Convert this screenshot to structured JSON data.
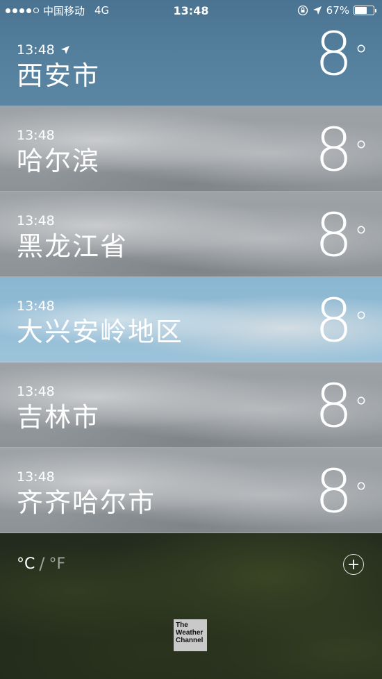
{
  "status_bar": {
    "carrier": "中国移动",
    "network": "4G",
    "time": "13:48",
    "battery_percent": "67%",
    "battery_level": 0.67,
    "signal_bars_filled": 4,
    "signal_bars_total": 5,
    "icons": [
      "rotation-lock-icon",
      "location-arrow-icon",
      "battery-icon"
    ]
  },
  "cities": [
    {
      "time": "13:48",
      "name": "西安市",
      "temp": "8",
      "degree": "°",
      "current_location": true,
      "bg": "rain"
    },
    {
      "time": "13:48",
      "name": "哈尔滨",
      "temp": "8",
      "degree": "°",
      "current_location": false,
      "bg": "cloudy"
    },
    {
      "time": "13:48",
      "name": "黑龙江省",
      "temp": "8",
      "degree": "°",
      "current_location": false,
      "bg": "cloudy"
    },
    {
      "time": "13:48",
      "name": "大兴安岭地区",
      "temp": "8",
      "degree": "°",
      "current_location": false,
      "bg": "partly"
    },
    {
      "time": "13:48",
      "name": "吉林市",
      "temp": "8",
      "degree": "°",
      "current_location": false,
      "bg": "cloudy"
    },
    {
      "time": "13:48",
      "name": "齐齐哈尔市",
      "temp": "8",
      "degree": "°",
      "current_location": false,
      "bg": "cloudy"
    }
  ],
  "footer": {
    "celsius_label": "°C",
    "separator": "/",
    "fahrenheit_label": "°F",
    "selected_unit": "C",
    "logo_text_line1": "The",
    "logo_text_line2": "Weather",
    "logo_text_line3": "Channel"
  },
  "colors": {
    "rain_row": "#4f7b98",
    "cloudy_row": "#9a9fa3",
    "partly_row": "#8fb8d2"
  }
}
